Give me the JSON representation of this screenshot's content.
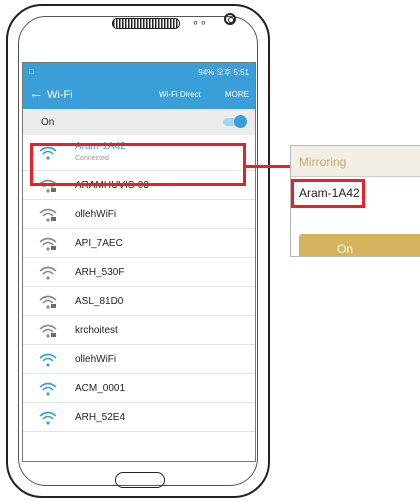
{
  "status_bar": {
    "left_icon": "notification-icon",
    "right_text": "94% 오후 5:51"
  },
  "app_bar": {
    "back_icon": "back-arrow-icon",
    "title": "Wi-Fi",
    "direct_label": "Wi-Fi Direct",
    "more_label": "MORE"
  },
  "wifi_toggle": {
    "label": "On",
    "state": "on"
  },
  "networks": [
    {
      "name": "Aram-1A42",
      "status": "Connected",
      "secured": false
    },
    {
      "name": "ARAMHUVIS-03",
      "secured": true
    },
    {
      "name": "ollehWiFi",
      "secured": true
    },
    {
      "name": "API_7AEC",
      "secured": true
    },
    {
      "name": "ARH_530F",
      "secured": false
    },
    {
      "name": "ASL_81D0",
      "secured": true
    },
    {
      "name": "krchoitest",
      "secured": true
    },
    {
      "name": "ollehWiFi",
      "secured": false
    },
    {
      "name": "ACM_0001",
      "secured": false
    },
    {
      "name": "ARH_52E4",
      "secured": false
    }
  ],
  "mirroring_panel": {
    "title": "Mirroring",
    "device_name": "Aram-1A42",
    "button_label": "On"
  },
  "colors": {
    "accent": "#3a9fd8",
    "highlight": "#e8202a",
    "gold": "#d6b45e"
  }
}
